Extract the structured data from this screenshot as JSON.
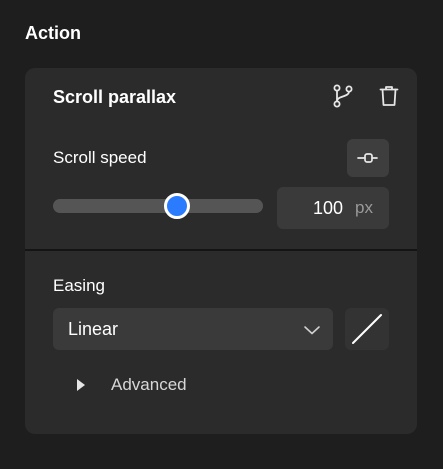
{
  "section": {
    "title": "Action"
  },
  "card": {
    "title": "Scroll parallax",
    "icons": {
      "branch": "branch-icon",
      "delete": "trash-icon"
    }
  },
  "scroll_speed": {
    "label": "Scroll speed",
    "value": "100",
    "unit": "px",
    "slider_fraction": 0.59,
    "unlink_icon": "unlink-icon"
  },
  "easing": {
    "label": "Easing",
    "selected": "Linear",
    "curve_icon": "linear-curve-icon"
  },
  "advanced": {
    "label": "Advanced"
  },
  "colors": {
    "background": "#1e1e1e",
    "card": "#2b2b2b",
    "field": "#3a3a3a",
    "accent": "#2b7bff"
  }
}
